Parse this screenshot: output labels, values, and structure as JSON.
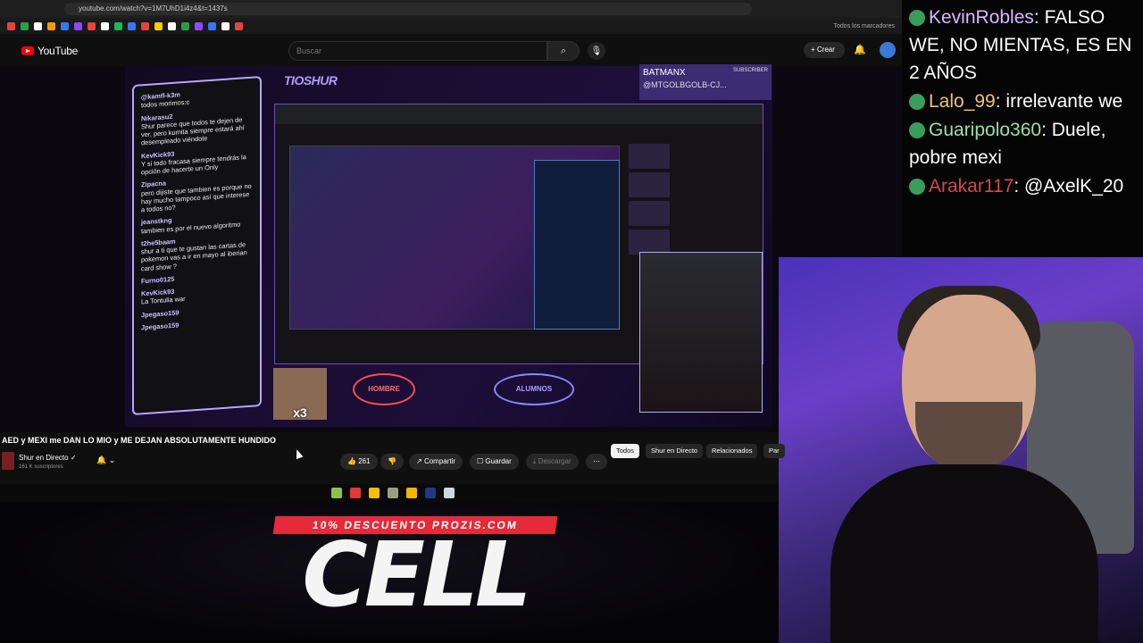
{
  "browser": {
    "url": "youtube.com/watch?v=1M7UhD1i4z4&t=1437s",
    "bookmarks_label": "Todos los marcadores"
  },
  "youtube": {
    "logo": "YouTube",
    "search_placeholder": "Buscar",
    "create_label": "Crear"
  },
  "stream": {
    "brand": "TIOSHUR",
    "batman_name": "BATMANX",
    "batman_sub": "SUBSCRIBER",
    "batman_handle": "@MTGOLBGOLB-CJ...",
    "label_left": "HOMBRE",
    "label_right": "ALUMNOS",
    "chat": [
      {
        "name": "@kamfl-k3m",
        "text": "todos morimos:c"
      },
      {
        "name": "Nikarasu2",
        "text": "Shur parece que todos te dejen de ver, pero kumita siempre estará ahí desempleado viéndote"
      },
      {
        "name": "KevKick93",
        "text": "Y si todo fracasa siempre tendrás la opción de hacerte un Only"
      },
      {
        "name": "Zipacna",
        "text": "pero dijiste que tambien es porque no hay mucho tampoco así que interese a todos no?"
      },
      {
        "name": "jeanstkng",
        "text": "tambien es por el nuevo algoritmo"
      },
      {
        "name": "t2he5baam",
        "text": "shur a ti que te gustan las cartas de pokemon vas a ir en mayo al iberian card show ?"
      },
      {
        "name": "Furno0125",
        "text": ""
      },
      {
        "name": "KevKick93",
        "text": "La Tontulia war"
      },
      {
        "name": "Jpegaso159",
        "text": ""
      },
      {
        "name": "Jpegaso159",
        "text": ""
      }
    ]
  },
  "video": {
    "title": "AED y MEXI me DAN LO MIO y ME DEJAN ABSOLUTAMENTE HUNDIDO",
    "channel": "Shur en Directo",
    "subscribers": "161 K suscriptores",
    "likes": "261",
    "share_label": "Compartir",
    "save_label": "Guardar",
    "download_label": "Descargar",
    "chips": [
      "Todos",
      "Shur en Directo",
      "Relacionados",
      "Par"
    ]
  },
  "overlay": {
    "promo": "10% DESCUENTO PROZIS.COM",
    "code": "CELL"
  },
  "right_chat": [
    {
      "name": "KevinRobles",
      "text": ": FALSO WE, NO MIENTAS, ES EN 2 AÑOS",
      "color": "#d9b8ff"
    },
    {
      "name": "Lalo_99",
      "text": ": irrelevante we",
      "color": "#f0c37a"
    },
    {
      "name": "Guaripolo360",
      "text": ": Duele, pobre mexi",
      "color": "#9ce0a8"
    },
    {
      "name": "Arakar117",
      "text": ": @AxelK_20",
      "color": "#d14a4a"
    }
  ]
}
